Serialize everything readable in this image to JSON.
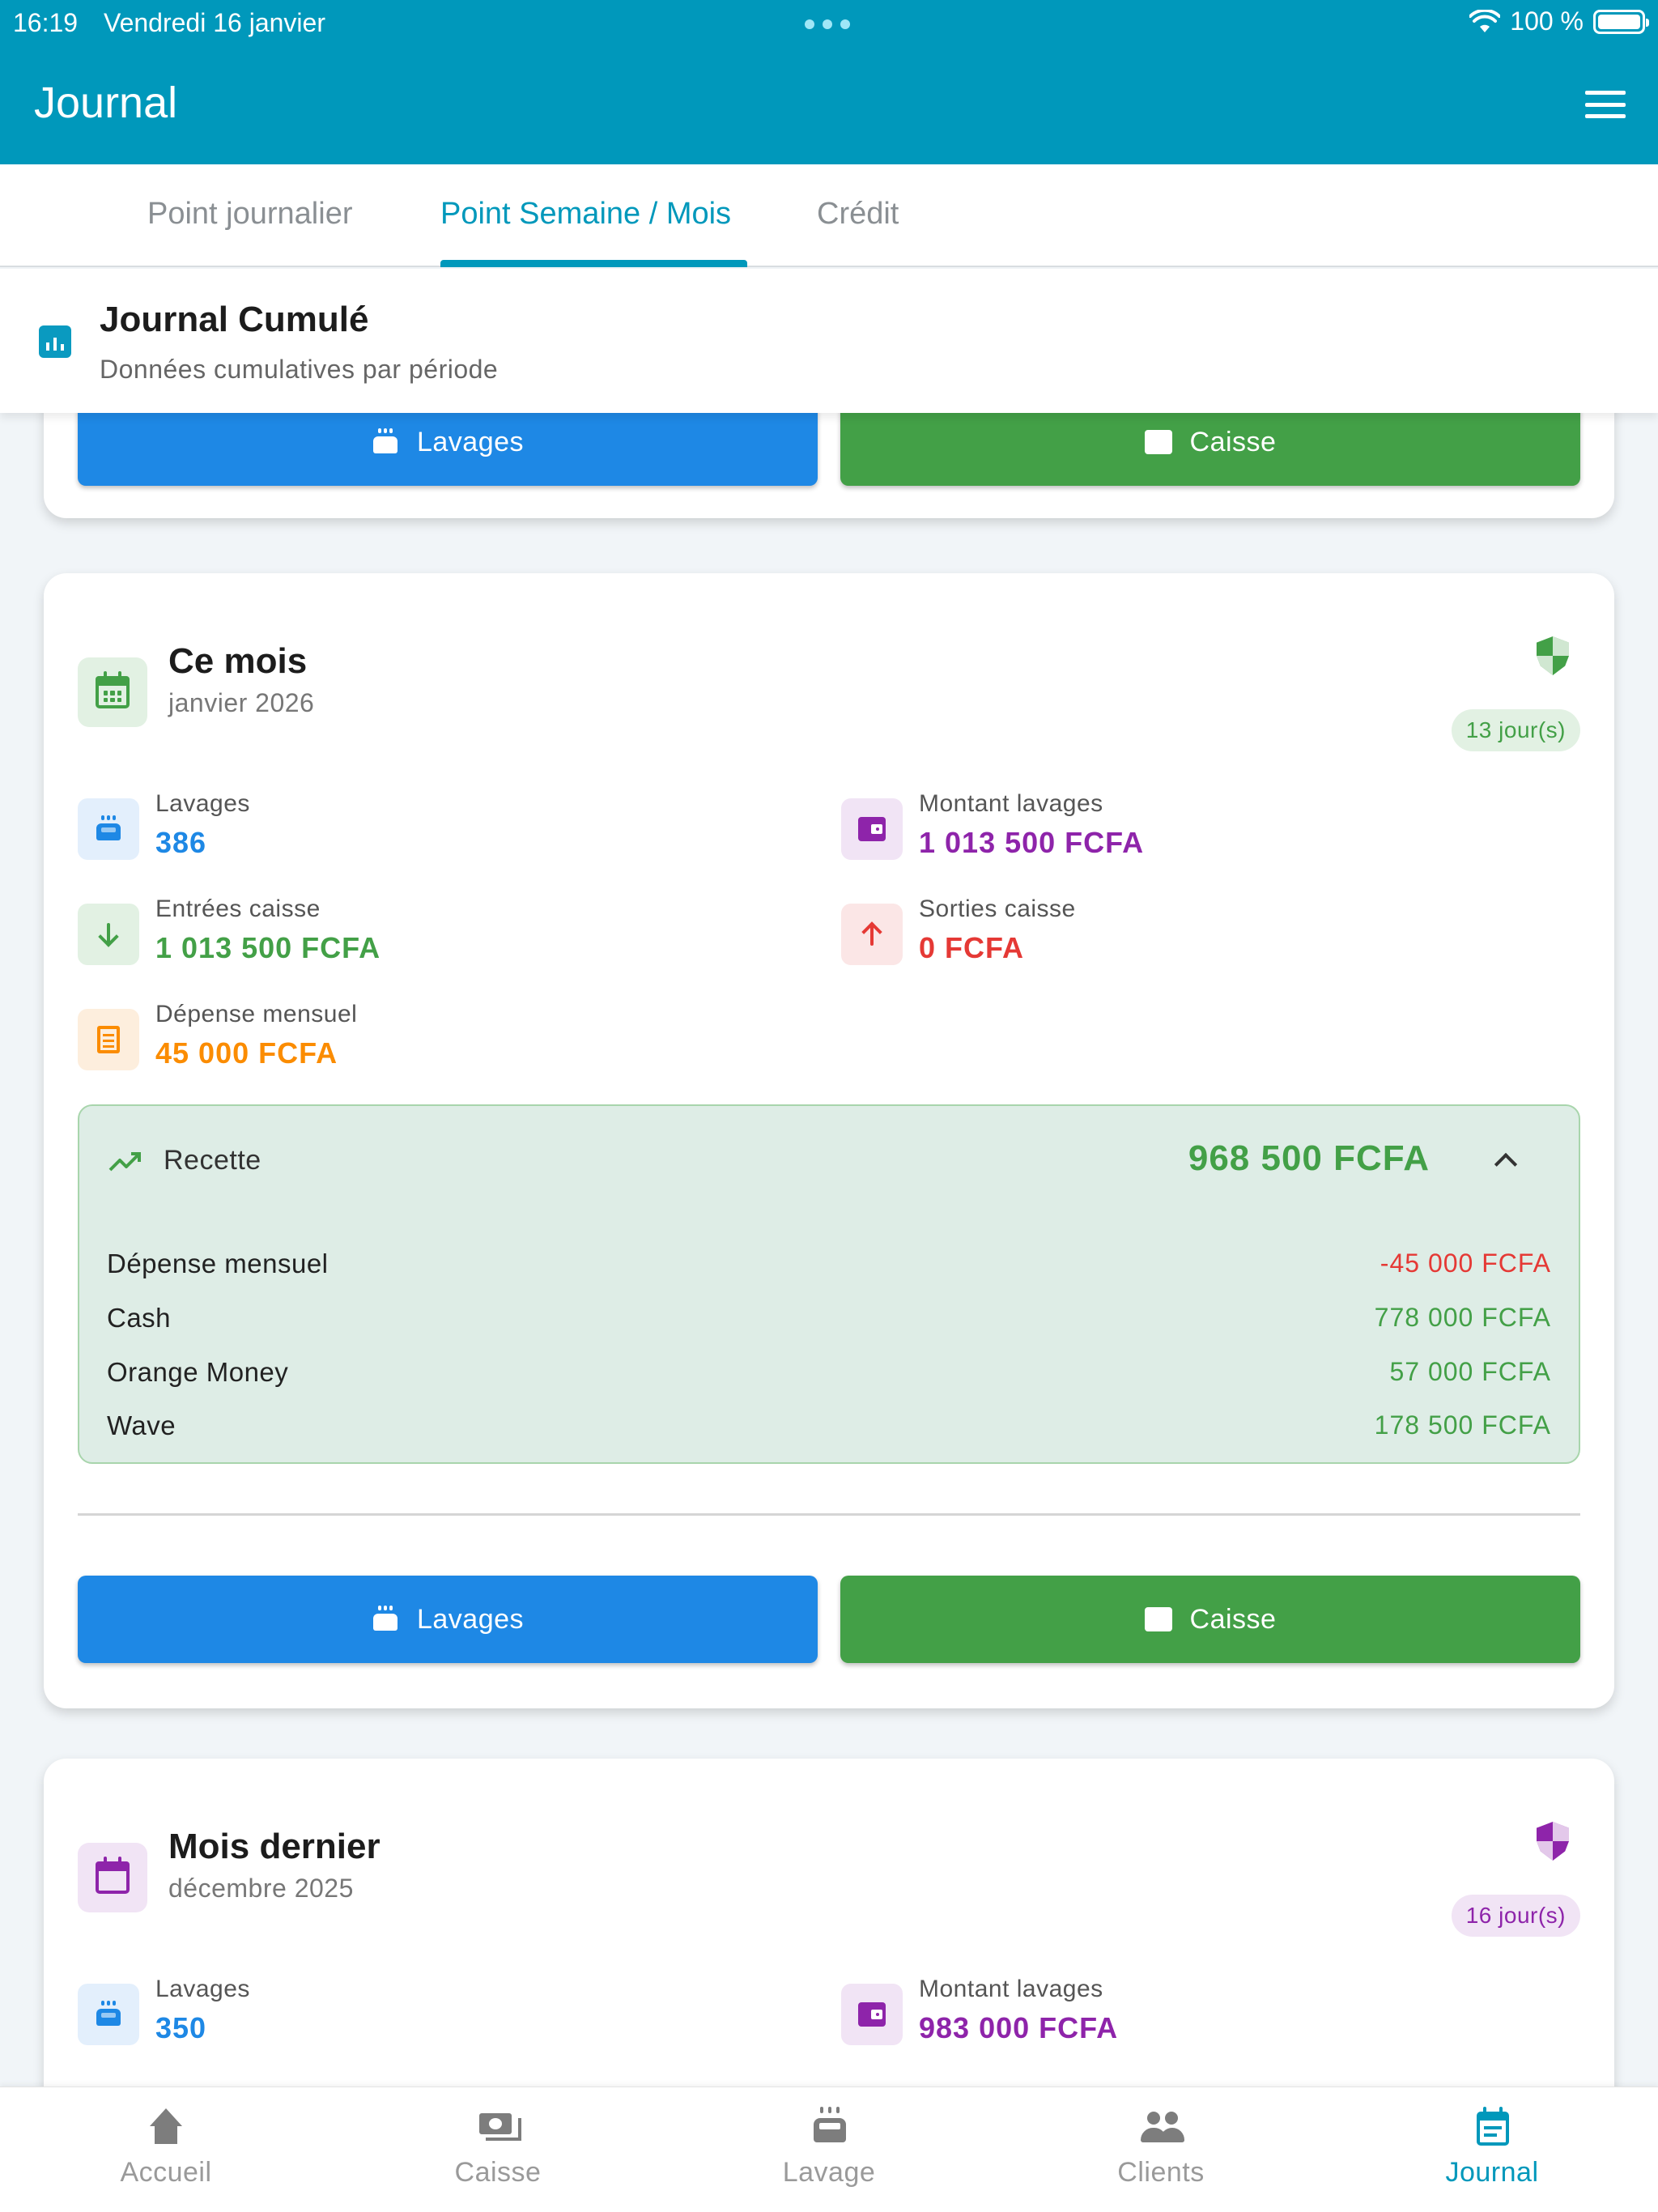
{
  "status_bar": {
    "time": "16:19",
    "date": "Vendredi 16 janvier",
    "battery": "100 %"
  },
  "app_bar": {
    "title": "Journal"
  },
  "tabs": [
    {
      "label": "Point journalier",
      "active": false
    },
    {
      "label": "Point Semaine / Mois",
      "active": true
    },
    {
      "label": "Crédit",
      "active": false
    }
  ],
  "section": {
    "title": "Journal Cumulé",
    "subtitle": "Données cumulatives par période"
  },
  "buttons": {
    "lavages": "Lavages",
    "caisse": "Caisse"
  },
  "current_month": {
    "title": "Ce mois",
    "subtitle": "janvier 2026",
    "days_badge": "13 jour(s)",
    "stats": {
      "lavages_label": "Lavages",
      "lavages_value": "386",
      "montant_label": "Montant lavages",
      "montant_value": "1 013 500 FCFA",
      "entrees_label": "Entrées caisse",
      "entrees_value": "1 013 500 FCFA",
      "sorties_label": "Sorties caisse",
      "sorties_value": "0 FCFA",
      "depense_label": "Dépense mensuel",
      "depense_value": "45 000 FCFA"
    },
    "recette": {
      "label": "Recette",
      "total": "968 500 FCFA",
      "rows": [
        {
          "label": "Dépense mensuel",
          "value": "-45 000 FCFA"
        },
        {
          "label": "Cash",
          "value": "778 000 FCFA"
        },
        {
          "label": "Orange Money",
          "value": "57 000 FCFA"
        },
        {
          "label": "Wave",
          "value": "178 500 FCFA"
        }
      ]
    }
  },
  "last_month": {
    "title": "Mois dernier",
    "subtitle": "décembre 2025",
    "days_badge": "16 jour(s)",
    "stats": {
      "lavages_label": "Lavages",
      "lavages_value": "350",
      "montant_label": "Montant lavages",
      "montant_value": "983 000 FCFA"
    }
  },
  "bottom_nav": [
    {
      "label": "Accueil",
      "icon": "home-icon"
    },
    {
      "label": "Caisse",
      "icon": "cash-icon"
    },
    {
      "label": "Lavage",
      "icon": "car-wash-icon"
    },
    {
      "label": "Clients",
      "icon": "people-icon"
    },
    {
      "label": "Journal",
      "icon": "journal-icon",
      "active": true
    }
  ],
  "colors": {
    "primary": "#0098bb",
    "blue": "#1e88e5",
    "green": "#43a047",
    "purple": "#8e24aa",
    "orange": "#fb8c00",
    "red": "#e53935"
  }
}
